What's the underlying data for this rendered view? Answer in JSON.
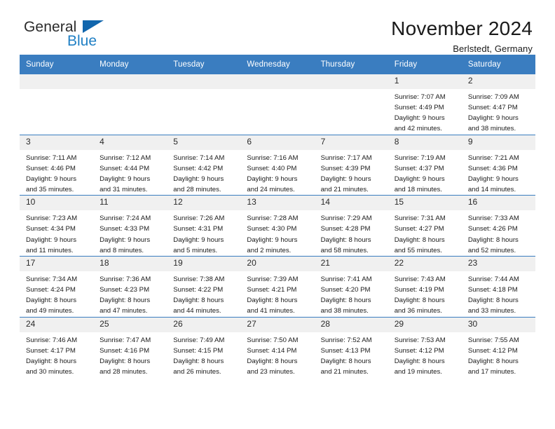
{
  "brand": {
    "name_top": "General",
    "name_bottom": "Blue",
    "triangle_color": "#1166ad",
    "blue_color": "#1f7fc4"
  },
  "header": {
    "title": "November 2024",
    "subtitle": "Berlstedt, Germany"
  },
  "theme": {
    "header_blue": "#3a7dc0",
    "daynum_bg": "#f0f0f0",
    "text": "#1a1a1a"
  },
  "weekdays": [
    "Sunday",
    "Monday",
    "Tuesday",
    "Wednesday",
    "Thursday",
    "Friday",
    "Saturday"
  ],
  "labels": {
    "sunrise_prefix": "Sunrise:",
    "sunset_prefix": "Sunset:",
    "daylight_prefix": "Daylight:"
  },
  "weeks": [
    [
      {
        "day": "",
        "blank": true
      },
      {
        "day": "",
        "blank": true
      },
      {
        "day": "",
        "blank": true
      },
      {
        "day": "",
        "blank": true
      },
      {
        "day": "",
        "blank": true
      },
      {
        "day": "1",
        "sunrise": "Sunrise: 7:07 AM",
        "sunset": "Sunset: 4:49 PM",
        "daylight1": "Daylight: 9 hours",
        "daylight2": "and 42 minutes."
      },
      {
        "day": "2",
        "sunrise": "Sunrise: 7:09 AM",
        "sunset": "Sunset: 4:47 PM",
        "daylight1": "Daylight: 9 hours",
        "daylight2": "and 38 minutes."
      }
    ],
    [
      {
        "day": "3",
        "sunrise": "Sunrise: 7:11 AM",
        "sunset": "Sunset: 4:46 PM",
        "daylight1": "Daylight: 9 hours",
        "daylight2": "and 35 minutes."
      },
      {
        "day": "4",
        "sunrise": "Sunrise: 7:12 AM",
        "sunset": "Sunset: 4:44 PM",
        "daylight1": "Daylight: 9 hours",
        "daylight2": "and 31 minutes."
      },
      {
        "day": "5",
        "sunrise": "Sunrise: 7:14 AM",
        "sunset": "Sunset: 4:42 PM",
        "daylight1": "Daylight: 9 hours",
        "daylight2": "and 28 minutes."
      },
      {
        "day": "6",
        "sunrise": "Sunrise: 7:16 AM",
        "sunset": "Sunset: 4:40 PM",
        "daylight1": "Daylight: 9 hours",
        "daylight2": "and 24 minutes."
      },
      {
        "day": "7",
        "sunrise": "Sunrise: 7:17 AM",
        "sunset": "Sunset: 4:39 PM",
        "daylight1": "Daylight: 9 hours",
        "daylight2": "and 21 minutes."
      },
      {
        "day": "8",
        "sunrise": "Sunrise: 7:19 AM",
        "sunset": "Sunset: 4:37 PM",
        "daylight1": "Daylight: 9 hours",
        "daylight2": "and 18 minutes."
      },
      {
        "day": "9",
        "sunrise": "Sunrise: 7:21 AM",
        "sunset": "Sunset: 4:36 PM",
        "daylight1": "Daylight: 9 hours",
        "daylight2": "and 14 minutes."
      }
    ],
    [
      {
        "day": "10",
        "sunrise": "Sunrise: 7:23 AM",
        "sunset": "Sunset: 4:34 PM",
        "daylight1": "Daylight: 9 hours",
        "daylight2": "and 11 minutes."
      },
      {
        "day": "11",
        "sunrise": "Sunrise: 7:24 AM",
        "sunset": "Sunset: 4:33 PM",
        "daylight1": "Daylight: 9 hours",
        "daylight2": "and 8 minutes."
      },
      {
        "day": "12",
        "sunrise": "Sunrise: 7:26 AM",
        "sunset": "Sunset: 4:31 PM",
        "daylight1": "Daylight: 9 hours",
        "daylight2": "and 5 minutes."
      },
      {
        "day": "13",
        "sunrise": "Sunrise: 7:28 AM",
        "sunset": "Sunset: 4:30 PM",
        "daylight1": "Daylight: 9 hours",
        "daylight2": "and 2 minutes."
      },
      {
        "day": "14",
        "sunrise": "Sunrise: 7:29 AM",
        "sunset": "Sunset: 4:28 PM",
        "daylight1": "Daylight: 8 hours",
        "daylight2": "and 58 minutes."
      },
      {
        "day": "15",
        "sunrise": "Sunrise: 7:31 AM",
        "sunset": "Sunset: 4:27 PM",
        "daylight1": "Daylight: 8 hours",
        "daylight2": "and 55 minutes."
      },
      {
        "day": "16",
        "sunrise": "Sunrise: 7:33 AM",
        "sunset": "Sunset: 4:26 PM",
        "daylight1": "Daylight: 8 hours",
        "daylight2": "and 52 minutes."
      }
    ],
    [
      {
        "day": "17",
        "sunrise": "Sunrise: 7:34 AM",
        "sunset": "Sunset: 4:24 PM",
        "daylight1": "Daylight: 8 hours",
        "daylight2": "and 49 minutes."
      },
      {
        "day": "18",
        "sunrise": "Sunrise: 7:36 AM",
        "sunset": "Sunset: 4:23 PM",
        "daylight1": "Daylight: 8 hours",
        "daylight2": "and 47 minutes."
      },
      {
        "day": "19",
        "sunrise": "Sunrise: 7:38 AM",
        "sunset": "Sunset: 4:22 PM",
        "daylight1": "Daylight: 8 hours",
        "daylight2": "and 44 minutes."
      },
      {
        "day": "20",
        "sunrise": "Sunrise: 7:39 AM",
        "sunset": "Sunset: 4:21 PM",
        "daylight1": "Daylight: 8 hours",
        "daylight2": "and 41 minutes."
      },
      {
        "day": "21",
        "sunrise": "Sunrise: 7:41 AM",
        "sunset": "Sunset: 4:20 PM",
        "daylight1": "Daylight: 8 hours",
        "daylight2": "and 38 minutes."
      },
      {
        "day": "22",
        "sunrise": "Sunrise: 7:43 AM",
        "sunset": "Sunset: 4:19 PM",
        "daylight1": "Daylight: 8 hours",
        "daylight2": "and 36 minutes."
      },
      {
        "day": "23",
        "sunrise": "Sunrise: 7:44 AM",
        "sunset": "Sunset: 4:18 PM",
        "daylight1": "Daylight: 8 hours",
        "daylight2": "and 33 minutes."
      }
    ],
    [
      {
        "day": "24",
        "sunrise": "Sunrise: 7:46 AM",
        "sunset": "Sunset: 4:17 PM",
        "daylight1": "Daylight: 8 hours",
        "daylight2": "and 30 minutes."
      },
      {
        "day": "25",
        "sunrise": "Sunrise: 7:47 AM",
        "sunset": "Sunset: 4:16 PM",
        "daylight1": "Daylight: 8 hours",
        "daylight2": "and 28 minutes."
      },
      {
        "day": "26",
        "sunrise": "Sunrise: 7:49 AM",
        "sunset": "Sunset: 4:15 PM",
        "daylight1": "Daylight: 8 hours",
        "daylight2": "and 26 minutes."
      },
      {
        "day": "27",
        "sunrise": "Sunrise: 7:50 AM",
        "sunset": "Sunset: 4:14 PM",
        "daylight1": "Daylight: 8 hours",
        "daylight2": "and 23 minutes."
      },
      {
        "day": "28",
        "sunrise": "Sunrise: 7:52 AM",
        "sunset": "Sunset: 4:13 PM",
        "daylight1": "Daylight: 8 hours",
        "daylight2": "and 21 minutes."
      },
      {
        "day": "29",
        "sunrise": "Sunrise: 7:53 AM",
        "sunset": "Sunset: 4:12 PM",
        "daylight1": "Daylight: 8 hours",
        "daylight2": "and 19 minutes."
      },
      {
        "day": "30",
        "sunrise": "Sunrise: 7:55 AM",
        "sunset": "Sunset: 4:12 PM",
        "daylight1": "Daylight: 8 hours",
        "daylight2": "and 17 minutes."
      }
    ]
  ]
}
